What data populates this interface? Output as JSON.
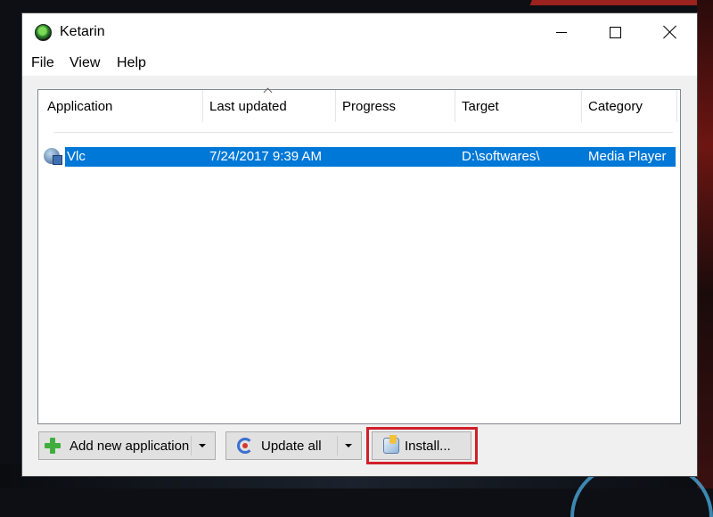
{
  "window": {
    "title": "Ketarin"
  },
  "menu": {
    "file": "File",
    "view": "View",
    "help": "Help"
  },
  "listview": {
    "columns": [
      "Application",
      "Last updated",
      "Progress",
      "Target",
      "Category"
    ],
    "sorted_column": "Last updated",
    "rows": [
      {
        "application": "Vlc",
        "last_updated": "7/24/2017 9:39 AM",
        "progress": "",
        "target": "D:\\softwares\\",
        "category": "Media Player",
        "selected": true
      }
    ]
  },
  "buttons": {
    "add_new_application": "Add new application",
    "update_all": "Update all",
    "install": "Install..."
  },
  "icons": {
    "app": "ketarin-app-icon",
    "row": "application-globe-icon",
    "add": "plus-icon",
    "update": "update-icon",
    "install": "install-icon"
  },
  "colors": {
    "selection": "#0078d7",
    "highlight_box": "#d0202a"
  }
}
